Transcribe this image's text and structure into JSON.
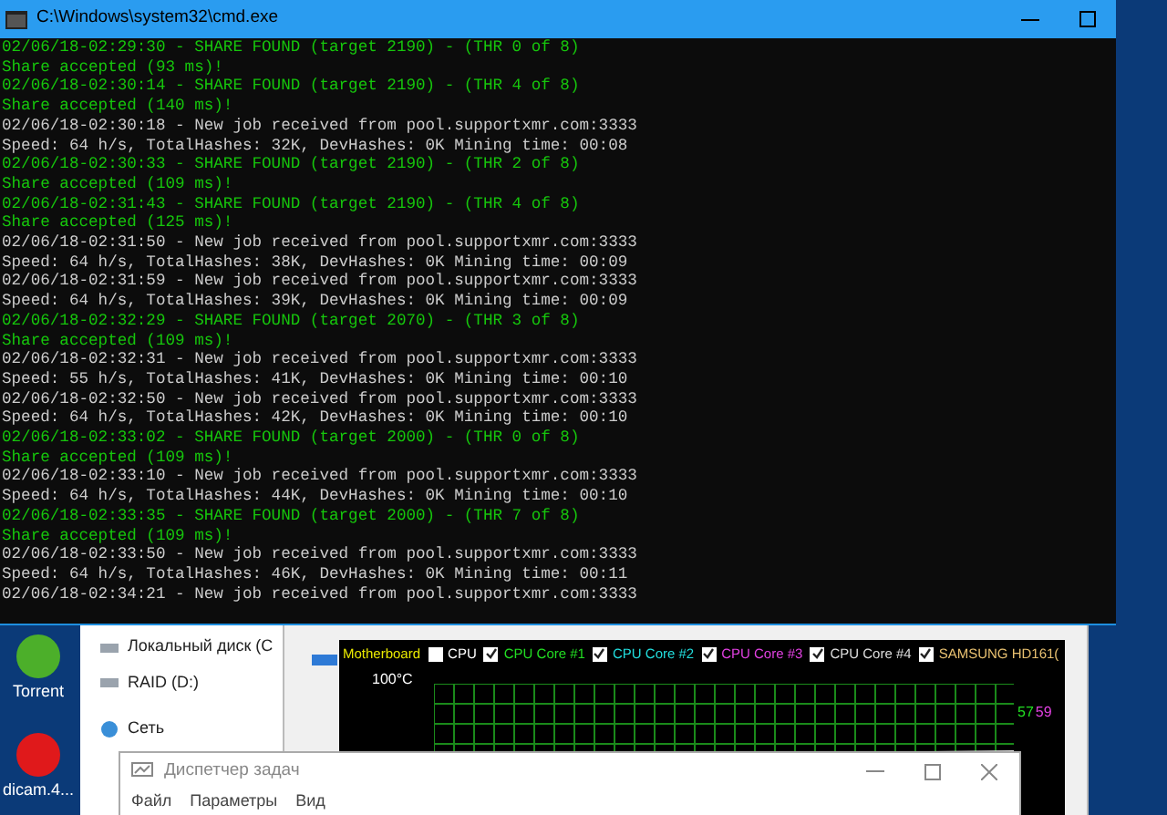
{
  "console_window": {
    "title": "C:\\Windows\\system32\\cmd.exe",
    "lines": [
      {
        "kind": "share",
        "text": "02/06/18-02:29:30 - SHARE FOUND (target 2190) - (THR 0 of 8)"
      },
      {
        "kind": "share",
        "text": "Share accepted (93 ms)!"
      },
      {
        "kind": "share",
        "text": "02/06/18-02:30:14 - SHARE FOUND (target 2190) - (THR 4 of 8)"
      },
      {
        "kind": "share",
        "text": "Share accepted (140 ms)!"
      },
      {
        "kind": "info",
        "text": "02/06/18-02:30:18 - New job received from pool.supportxmr.com:3333"
      },
      {
        "kind": "info",
        "text": "Speed: 64 h/s, TotalHashes: 32K, DevHashes: 0K Mining time: 00:08"
      },
      {
        "kind": "share",
        "text": "02/06/18-02:30:33 - SHARE FOUND (target 2190) - (THR 2 of 8)"
      },
      {
        "kind": "share",
        "text": "Share accepted (109 ms)!"
      },
      {
        "kind": "share",
        "text": "02/06/18-02:31:43 - SHARE FOUND (target 2190) - (THR 4 of 8)"
      },
      {
        "kind": "share",
        "text": "Share accepted (125 ms)!"
      },
      {
        "kind": "info",
        "text": "02/06/18-02:31:50 - New job received from pool.supportxmr.com:3333"
      },
      {
        "kind": "info",
        "text": "Speed: 64 h/s, TotalHashes: 38K, DevHashes: 0K Mining time: 00:09"
      },
      {
        "kind": "info",
        "text": "02/06/18-02:31:59 - New job received from pool.supportxmr.com:3333"
      },
      {
        "kind": "info",
        "text": "Speed: 64 h/s, TotalHashes: 39K, DevHashes: 0K Mining time: 00:09"
      },
      {
        "kind": "share",
        "text": "02/06/18-02:32:29 - SHARE FOUND (target 2070) - (THR 3 of 8)"
      },
      {
        "kind": "share",
        "text": "Share accepted (109 ms)!"
      },
      {
        "kind": "info",
        "text": "02/06/18-02:32:31 - New job received from pool.supportxmr.com:3333"
      },
      {
        "kind": "info",
        "text": "Speed: 55 h/s, TotalHashes: 41K, DevHashes: 0K Mining time: 00:10"
      },
      {
        "kind": "info",
        "text": "02/06/18-02:32:50 - New job received from pool.supportxmr.com:3333"
      },
      {
        "kind": "info",
        "text": "Speed: 64 h/s, TotalHashes: 42K, DevHashes: 0K Mining time: 00:10"
      },
      {
        "kind": "share",
        "text": "02/06/18-02:33:02 - SHARE FOUND (target 2000) - (THR 0 of 8)"
      },
      {
        "kind": "share",
        "text": "Share accepted (109 ms)!"
      },
      {
        "kind": "info",
        "text": "02/06/18-02:33:10 - New job received from pool.supportxmr.com:3333"
      },
      {
        "kind": "info",
        "text": "Speed: 64 h/s, TotalHashes: 44K, DevHashes: 0K Mining time: 00:10"
      },
      {
        "kind": "share",
        "text": "02/06/18-02:33:35 - SHARE FOUND (target 2000) - (THR 7 of 8)"
      },
      {
        "kind": "share",
        "text": "Share accepted (109 ms)!"
      },
      {
        "kind": "info",
        "text": "02/06/18-02:33:50 - New job received from pool.supportxmr.com:3333"
      },
      {
        "kind": "info",
        "text": "Speed: 64 h/s, TotalHashes: 46K, DevHashes: 0K Mining time: 00:11"
      },
      {
        "kind": "info",
        "text": "02/06/18-02:34:21 - New job received from pool.supportxmr.com:3333"
      }
    ]
  },
  "desktop_icons": [
    {
      "label": "Torrent",
      "color": "#4caf2a"
    },
    {
      "label": "dicam.4...",
      "color": "#e0191b"
    }
  ],
  "explorer": {
    "items": [
      "Локальный диск (С",
      "RAID (D:)",
      "Сеть"
    ]
  },
  "monitor": {
    "legend": [
      {
        "kind": "plain",
        "label": "Motherboard",
        "color": "#e8e800"
      },
      {
        "kind": "checkbox",
        "label": "CPU",
        "color": "#ffffff",
        "checked": false
      },
      {
        "kind": "checkbox",
        "label": "CPU Core #1",
        "color": "#22dd22",
        "checked": true
      },
      {
        "kind": "checkbox",
        "label": "CPU Core #2",
        "color": "#22dddd",
        "checked": true
      },
      {
        "kind": "checkbox",
        "label": "CPU Core #3",
        "color": "#e040e0",
        "checked": true
      },
      {
        "kind": "checkbox",
        "label": "CPU Core #4",
        "color": "#dddddd",
        "checked": true
      },
      {
        "kind": "checkbox",
        "label": "SAMSUNG HD161(",
        "color": "#e8c070",
        "checked": true
      }
    ],
    "y_top": "100°C",
    "readings": [
      {
        "text": "57",
        "color": "#22dd22"
      },
      {
        "text": "59",
        "color": "#e040e0"
      }
    ]
  },
  "task_manager": {
    "title": "Диспетчер задач",
    "menu": [
      "Файл",
      "Параметры",
      "Вид"
    ]
  }
}
